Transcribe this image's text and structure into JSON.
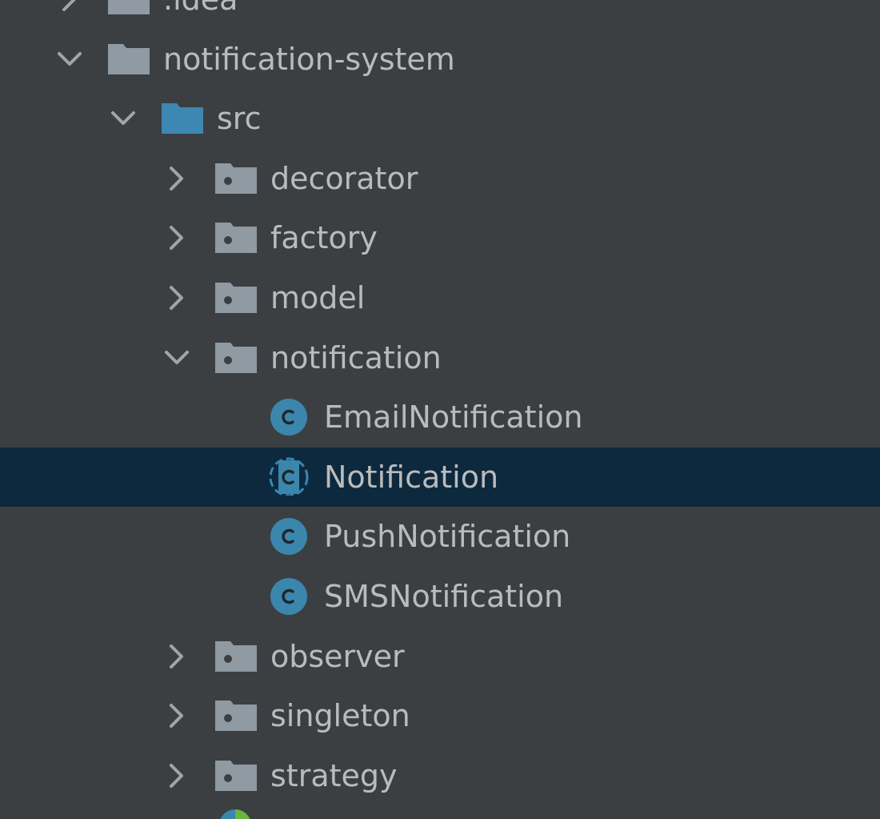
{
  "project_tree": {
    "items": [
      {
        "label": ".idea",
        "name": "tree-item-idea",
        "icon": "folder-icon",
        "chevron": "chevron-right-icon",
        "level": 0
      },
      {
        "label": "notification-system",
        "name": "tree-item-notification-system",
        "icon": "folder-icon",
        "chevron": "chevron-down-icon",
        "level": 0
      },
      {
        "label": "src",
        "name": "tree-item-src",
        "icon": "source-folder-icon",
        "chevron": "chevron-down-icon",
        "level": 1
      },
      {
        "label": "decorator",
        "name": "tree-item-decorator",
        "icon": "package-icon",
        "chevron": "chevron-right-icon",
        "level": 2
      },
      {
        "label": "factory",
        "name": "tree-item-factory",
        "icon": "package-icon",
        "chevron": "chevron-right-icon",
        "level": 2
      },
      {
        "label": "model",
        "name": "tree-item-model",
        "icon": "package-icon",
        "chevron": "chevron-right-icon",
        "level": 2
      },
      {
        "label": "notification",
        "name": "tree-item-notification",
        "icon": "package-icon",
        "chevron": "chevron-down-icon",
        "level": 2
      },
      {
        "label": "EmailNotification",
        "name": "tree-item-email-notification",
        "icon": "class-icon",
        "chevron": "",
        "level": 3
      },
      {
        "label": "Notification",
        "name": "tree-item-notification-class",
        "icon": "abstract-class-icon",
        "chevron": "",
        "level": 3,
        "selected": true
      },
      {
        "label": "PushNotification",
        "name": "tree-item-push-notification",
        "icon": "class-icon",
        "chevron": "",
        "level": 3
      },
      {
        "label": "SMSNotification",
        "name": "tree-item-sms-notification",
        "icon": "class-icon",
        "chevron": "",
        "level": 3
      },
      {
        "label": "observer",
        "name": "tree-item-observer",
        "icon": "package-icon",
        "chevron": "chevron-right-icon",
        "level": 2
      },
      {
        "label": "singleton",
        "name": "tree-item-singleton",
        "icon": "package-icon",
        "chevron": "chevron-right-icon",
        "level": 2
      },
      {
        "label": "strategy",
        "name": "tree-item-strategy",
        "icon": "package-icon",
        "chevron": "chevron-right-icon",
        "level": 2
      }
    ],
    "partial_icon": "test-resource-icon"
  },
  "colors": {
    "background": "#3c3f41",
    "selection": "#0d293e",
    "text": "#bbbbbb",
    "folder": "#8f9aa3",
    "source_folder": "#3d87b3",
    "class_icon": "#3b86ad",
    "chevron": "#a0a5a9"
  }
}
